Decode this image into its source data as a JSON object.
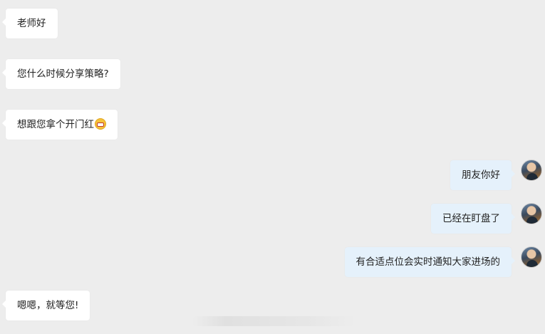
{
  "messages": [
    {
      "side": "left",
      "text": "老师好"
    },
    {
      "side": "left",
      "text": "您什么时候分享策略?"
    },
    {
      "side": "left",
      "text": "想跟您拿个开门红",
      "emoji": "grinning-face-emoji"
    },
    {
      "side": "right",
      "text": "朋友你好",
      "avatar": "user-avatar"
    },
    {
      "side": "right",
      "text": "已经在盯盘了",
      "avatar": "user-avatar"
    },
    {
      "side": "right",
      "text": "有合适点位会实时通知大家进场的",
      "avatar": "user-avatar"
    },
    {
      "side": "left",
      "text": "嗯嗯，就等您!"
    }
  ],
  "colors": {
    "background": "#ededed",
    "left_bubble": "#ffffff",
    "right_bubble": "#e5f1fb",
    "text": "#222222"
  }
}
